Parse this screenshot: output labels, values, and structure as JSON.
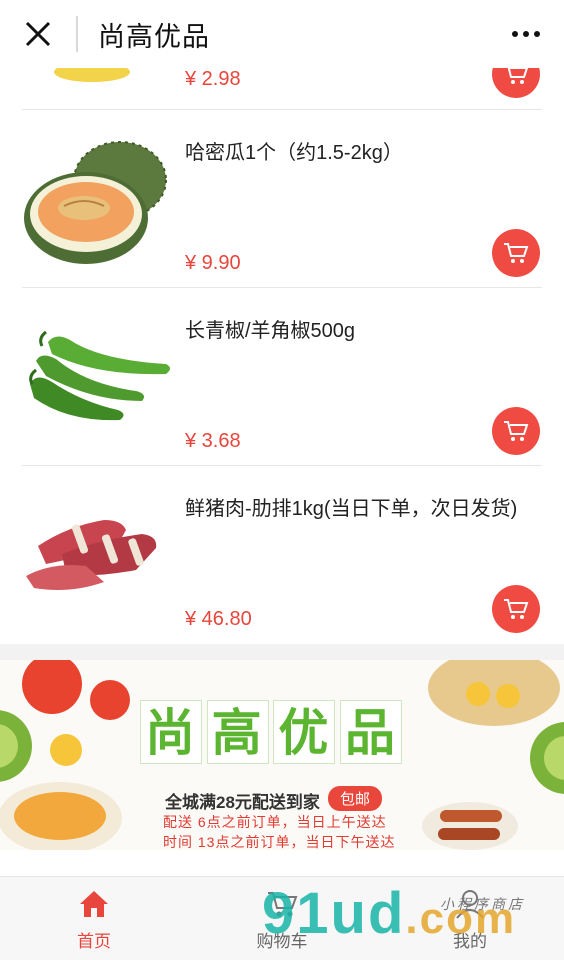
{
  "header": {
    "title": "尚高优品"
  },
  "products": [
    {
      "name": "",
      "price": "¥ 2.98"
    },
    {
      "name": "哈密瓜1个（约1.5-2kg）",
      "price": "¥ 9.90"
    },
    {
      "name": "长青椒/羊角椒500g",
      "price": "¥ 3.68"
    },
    {
      "name": "鲜猪肉-肋排1kg(当日下单，次日发货)",
      "price": "¥ 46.80"
    }
  ],
  "banner": {
    "title_chars": [
      "尚",
      "高",
      "优",
      "品"
    ],
    "line1": "全城满28元配送到家",
    "badge": "包邮",
    "line2": "配送  6点之前订单，当日上午送达",
    "line3": "时间  13点之前订单，当日下午送达"
  },
  "bottom_nav": [
    {
      "label": "首页",
      "icon": "home-icon",
      "active": true
    },
    {
      "label": "购物车",
      "icon": "cart-icon",
      "active": false
    },
    {
      "label": "我的",
      "icon": "user-icon",
      "active": false
    }
  ],
  "watermark": {
    "main": "91ud",
    "suffix": ".com",
    "small": "小程序商店"
  },
  "colors": {
    "accent": "#e8453c",
    "banner_green": "#5cb531",
    "watermark": "#18b5a9"
  }
}
